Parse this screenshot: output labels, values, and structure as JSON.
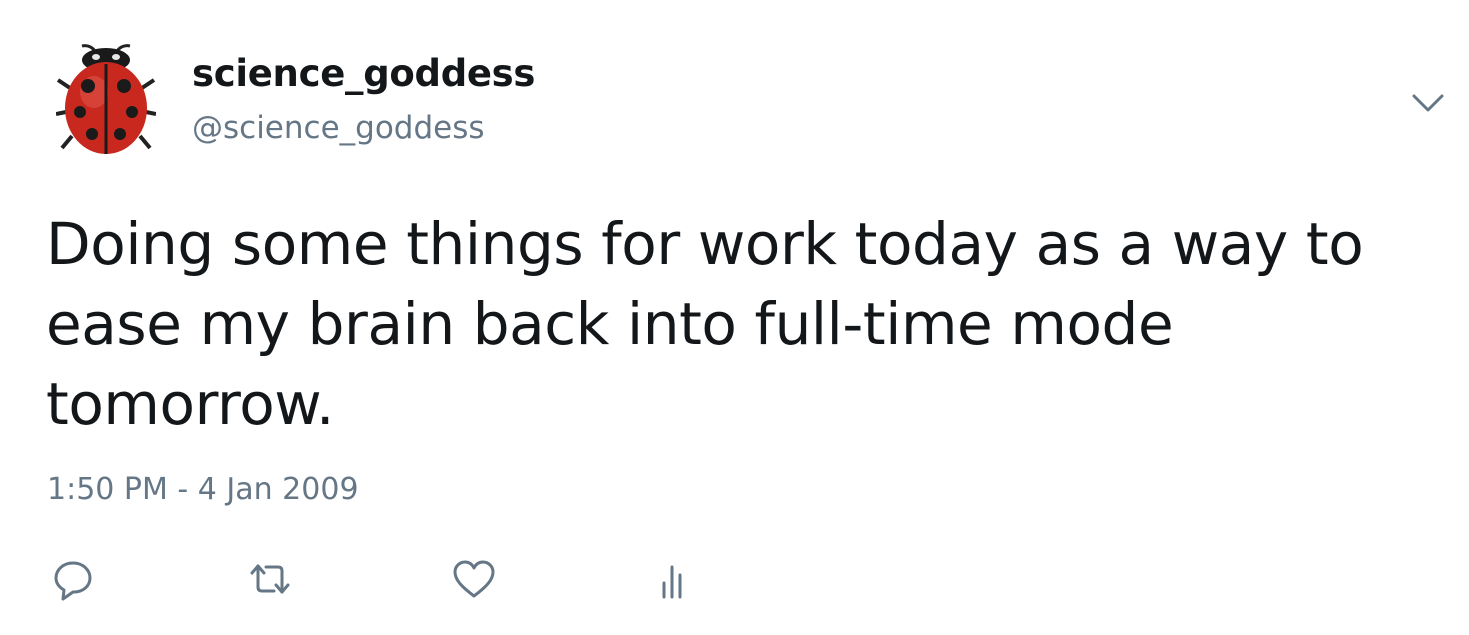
{
  "user": {
    "display_name": "science_goddess",
    "handle": "@science_goddess",
    "avatar_icon": "ladybug-avatar"
  },
  "tweet": {
    "text": "Doing some things for work today as a way to ease my brain back into full-time mode tomorrow.",
    "timestamp": "1:50 PM - 4 Jan 2009"
  },
  "icons": {
    "menu": "chevron-down-icon",
    "reply": "reply-icon",
    "retweet": "retweet-icon",
    "like": "heart-icon",
    "stats": "analytics-icon"
  },
  "colors": {
    "text_primary": "#14171a",
    "text_secondary": "#657786",
    "ladybug_red": "#c8281e"
  }
}
